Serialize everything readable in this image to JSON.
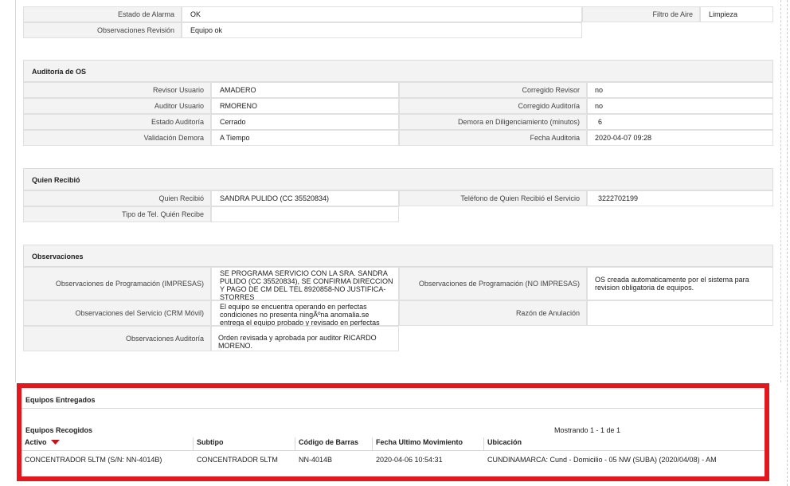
{
  "top": {
    "estado_alarma_label": "Estado de Alarma",
    "estado_alarma_value": "OK",
    "filtro_aire_label": "Filtro de Aire",
    "filtro_aire_value": "Limpieza",
    "obs_revision_label": "Observaciones Revisión",
    "obs_revision_value": "Equipo ok"
  },
  "auditoria": {
    "title": "Auditoría de OS",
    "revisor_usuario_label": "Revisor Usuario",
    "revisor_usuario_value": "AMADERO",
    "corregido_revisor_label": "Corregido Revisor",
    "corregido_revisor_value": "no",
    "auditor_usuario_label": "Auditor Usuario",
    "auditor_usuario_value": "RMORENO",
    "corregido_auditoria_label": "Corregido Auditoría",
    "corregido_auditoria_value": "no",
    "estado_auditoria_label": "Estado Auditoría",
    "estado_auditoria_value": "Cerrado",
    "demora_label": "Demora en Diligenciamiento (minutos)",
    "demora_value": "6",
    "validacion_label": "Validación Demora",
    "validacion_value": "A Tiempo",
    "fecha_auditoria_label": "Fecha Auditoria",
    "fecha_auditoria_value": "2020-04-07 09:28"
  },
  "quien_recibio": {
    "title": "Quien Recibió",
    "quien_label": "Quien Recibió",
    "quien_value": "SANDRA PULIDO (CC 35520834)",
    "telefono_label": "Teléfono de Quien Recibió el Servicio",
    "telefono_value": "3222702199",
    "tipo_tel_label": "Tipo de Tel. Quién Recibe",
    "tipo_tel_value": ""
  },
  "observaciones": {
    "title": "Observaciones",
    "prog_impresas_label": "Observaciones de Programación (IMPRESAS)",
    "prog_impresas_value": "SE PROGRAMA SERVICIO CON LA SRA. SANDRA PULIDO (CC 35520834), SE CONFIRMA DIRECCION Y PAGO DE CM DEL TEL 8920858-NO JUSTIFICA-STORRES",
    "prog_no_impresas_label": "Observaciones de Programación (NO IMPRESAS)",
    "prog_no_impresas_value": "OS creada automaticamente por el sistema para revision obligatoria de equipos.",
    "servicio_label": "Observaciones del Servicio (CRM Móvil)",
    "servicio_value": "El equipo se encuentra operando en perfectas condiciones no presenta ningÃºna anomalia.se entrega el equipo probado y revisado en perfectas condiciones",
    "anulacion_label": "Razón de Anulación",
    "anulacion_value": "",
    "auditoria_label": "Observaciones Auditoría",
    "auditoria_value": "Orden revisada y aprobada por auditor RICARDO MORENO."
  },
  "equipos": {
    "entregados_title": "Equipos Entregados",
    "recogidos_title": "Equipos Recogidos",
    "mostrando": "Mostrando 1 - 1 de 1",
    "columns": [
      "Activo",
      "Subtipo",
      "Código de Barras",
      "Fecha Ultimo Movimiento",
      "Ubicación"
    ],
    "rows": [
      [
        "CONCENTRADOR 5LTM (S/N: NN-4014B)",
        "CONCENTRADOR 5LTM",
        "NN-4014B",
        "2020-04-06 10:54:31",
        "CUNDINAMARCA: Cund - Domicilio - 05 NW (SUBA) (2020/04/08) - AM"
      ]
    ],
    "sort_color": "#c0151b",
    "highlight_color": "#e3171e"
  }
}
